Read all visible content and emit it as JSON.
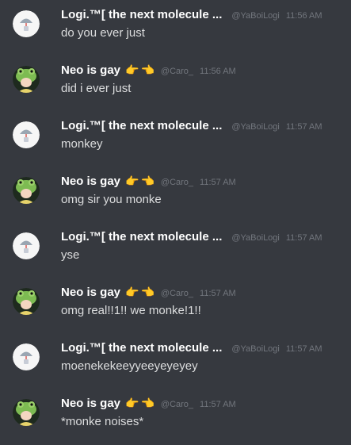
{
  "messages": [
    {
      "user": "Logi.™[ the next molecule ...",
      "handle": "@YaBoiLogi",
      "time": "11:56 AM",
      "text": "do you ever just",
      "avatar": "umbrella-avatar",
      "emoji": ""
    },
    {
      "user": "Neo is gay",
      "handle": "@Caro_",
      "time": "11:56 AM",
      "text": "did i ever just",
      "avatar": "frog-hat-avatar",
      "emoji": "👉👈"
    },
    {
      "user": "Logi.™[ the next molecule ...",
      "handle": "@YaBoiLogi",
      "time": "11:57 AM",
      "text": "monkey",
      "avatar": "umbrella-avatar",
      "emoji": ""
    },
    {
      "user": "Neo is gay",
      "handle": "@Caro_",
      "time": "11:57 AM",
      "text": "omg sir you monke",
      "avatar": "frog-hat-avatar",
      "emoji": "👉👈"
    },
    {
      "user": "Logi.™[ the next molecule ...",
      "handle": "@YaBoiLogi",
      "time": "11:57 AM",
      "text": "yse",
      "avatar": "umbrella-avatar",
      "emoji": ""
    },
    {
      "user": "Neo is gay",
      "handle": "@Caro_",
      "time": "11:57 AM",
      "text": "omg real!!1!! we monke!1!!",
      "avatar": "frog-hat-avatar",
      "emoji": "👉👈"
    },
    {
      "user": "Logi.™[ the next molecule ...",
      "handle": "@YaBoiLogi",
      "time": "11:57 AM",
      "text": "moenekekeeyyeeyeyeyey",
      "avatar": "umbrella-avatar",
      "emoji": ""
    },
    {
      "user": "Neo is gay",
      "handle": "@Caro_",
      "time": "11:57 AM",
      "text": "*monke noises*",
      "avatar": "frog-hat-avatar",
      "emoji": "👉👈"
    }
  ],
  "colors": {
    "background": "#36393f",
    "username": "#ffffff",
    "meta": "#72767d",
    "text": "#dcddde"
  }
}
